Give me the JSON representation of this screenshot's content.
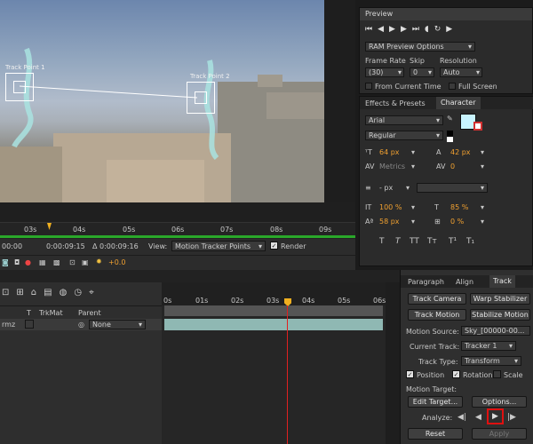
{
  "viewer": {
    "track_point_1_label": "Track Point 1",
    "track_point_2_label": "Track Point 2",
    "ruler_ticks": [
      "03s",
      "04s",
      "05s",
      "06s",
      "07s",
      "08s",
      "09s"
    ],
    "timecode_start": "0:00:09:15",
    "timecode_duration": "Δ 0:00:09:16",
    "view_label": "View:",
    "view_value": "Motion Tracker Points",
    "render_label": "Render",
    "exposure_value": "+0.0",
    "left_timecode": "00:00"
  },
  "preview": {
    "title": "Preview",
    "ram_preview": "RAM Preview Options",
    "frame_rate_label": "Frame Rate",
    "skip_label": "Skip",
    "resolution_label": "Resolution",
    "frame_rate_value": "(30)",
    "skip_value": "0",
    "resolution_value": "Auto",
    "from_current_time": "From Current Time",
    "full_screen": "Full Screen"
  },
  "character": {
    "tabs": [
      "Effects & Presets",
      "Character"
    ],
    "font": "Arial",
    "style": "Regular",
    "size": "64 px",
    "leading": "42 px",
    "kerning": "Metrics",
    "tracking": "0",
    "stroke_unit": "- px",
    "vert_scale": "100 %",
    "horiz_scale": "85 %",
    "baseline": "58 px",
    "tsume": "0 %",
    "fill_color": "#c8f4ff",
    "styles_buttons": [
      "T",
      "T",
      "TT",
      "Tт",
      "T¹",
      "T₁"
    ]
  },
  "timeline": {
    "header_cols": [
      "T",
      "TrkMat",
      "Parent"
    ],
    "row_name": "rmz",
    "parent_value": "None",
    "ruler_ticks": [
      "0s",
      "01s",
      "02s",
      "03s",
      "04s",
      "05s",
      "06s"
    ]
  },
  "tracker": {
    "tabs": [
      "Paragraph",
      "Align",
      "Track"
    ],
    "track_camera": "Track Camera",
    "warp_stabilizer": "Warp Stabilizer",
    "track_motion": "Track Motion",
    "stabilize_motion": "Stabilize Motion",
    "motion_source_label": "Motion Source:",
    "motion_source_value": "Sky_[00000-00...",
    "current_track_label": "Current Track:",
    "current_track_value": "Tracker 1",
    "track_type_label": "Track Type:",
    "track_type_value": "Transform",
    "position_label": "Position",
    "rotation_label": "Rotation",
    "scale_label": "Scale",
    "motion_target_label": "Motion Target:",
    "edit_target": "Edit Target...",
    "options": "Options...",
    "analyze_label": "Analyze:",
    "reset": "Reset",
    "apply": "Apply"
  }
}
